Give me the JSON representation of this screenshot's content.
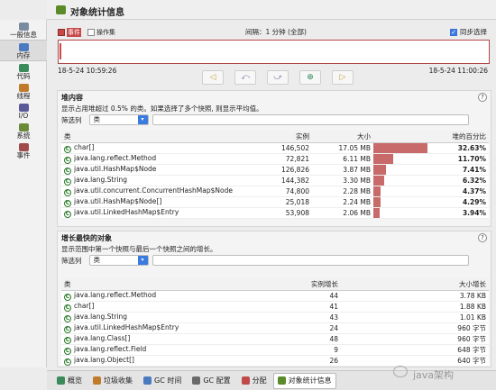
{
  "title": "对象统计信息",
  "sidebar": {
    "items": [
      {
        "label": "一般信息",
        "icon": "general-info-icon",
        "color": "#7a8aa0"
      },
      {
        "label": "内存",
        "icon": "memory-icon",
        "color": "#4a7abf"
      },
      {
        "label": "代码",
        "icon": "code-icon",
        "color": "#3a8a5a"
      },
      {
        "label": "线程",
        "icon": "threads-icon",
        "color": "#c07a2a"
      },
      {
        "label": "I/O",
        "icon": "io-icon",
        "color": "#5a5a9a"
      },
      {
        "label": "系统",
        "icon": "system-icon",
        "color": "#6a8a3a"
      },
      {
        "label": "事件",
        "icon": "events-icon",
        "color": "#a04a4a"
      }
    ],
    "active_index": 1
  },
  "timeline": {
    "legend": [
      {
        "label": "事件",
        "highlight": true
      },
      {
        "label": "操作集",
        "highlight": false
      }
    ],
    "interval": "间隔：1 分钟 (全部)",
    "sync_label": "同步选择",
    "sync_checked": true,
    "start_time": "18-5-24 10:59:26",
    "end_time": "18-5-24 11:00:26",
    "nav_buttons": [
      "◁",
      "⤺",
      "⤻",
      "⊕",
      "▷"
    ]
  },
  "heap": {
    "heading": "堆内容",
    "description": "显示占用堆超过 0.5% 的类。如果选择了多个快照, 则显示平均值。",
    "filter_label": "筛选列",
    "filter_value": "类",
    "columns": [
      "类",
      "实例",
      "大小",
      "堆的百分比"
    ],
    "rows": [
      {
        "name": "char[]",
        "instances": "146,502",
        "size": "17.05 MB",
        "percent": "32.63%",
        "fraction": 0.3263
      },
      {
        "name": "java.lang.reflect.Method",
        "instances": "72,821",
        "size": "6.11 MB",
        "percent": "11.70%",
        "fraction": 0.117
      },
      {
        "name": "java.util.HashMap$Node",
        "instances": "126,826",
        "size": "3.87 MB",
        "percent": "7.41%",
        "fraction": 0.0741
      },
      {
        "name": "java.lang.String",
        "instances": "144,382",
        "size": "3.30 MB",
        "percent": "6.32%",
        "fraction": 0.0632
      },
      {
        "name": "java.util.concurrent.ConcurrentHashMap$Node",
        "instances": "74,800",
        "size": "2.28 MB",
        "percent": "4.37%",
        "fraction": 0.0437
      },
      {
        "name": "java.util.HashMap$Node[]",
        "instances": "25,018",
        "size": "2.24 MB",
        "percent": "4.29%",
        "fraction": 0.0429
      },
      {
        "name": "java.util.LinkedHashMap$Entry",
        "instances": "53,908",
        "size": "2.06 MB",
        "percent": "3.94%",
        "fraction": 0.0394
      }
    ]
  },
  "growth": {
    "heading": "增长最快的对象",
    "description": "显示范围中第一个快照与最后一个快照之间的增长。",
    "filter_label": "筛选列",
    "filter_value": "类",
    "columns": [
      "类",
      "实例增长",
      "大小增长"
    ],
    "rows": [
      {
        "name": "java.lang.reflect.Method",
        "growth": "44",
        "size_growth": "3.78 KB"
      },
      {
        "name": "char[]",
        "growth": "41",
        "size_growth": "1.88 KB"
      },
      {
        "name": "java.lang.String",
        "growth": "43",
        "size_growth": "1.01 KB"
      },
      {
        "name": "java.util.LinkedHashMap$Entry",
        "growth": "24",
        "size_growth": "960 字节"
      },
      {
        "name": "java.lang.Class[]",
        "growth": "48",
        "size_growth": "960 字节"
      },
      {
        "name": "java.lang.reflect.Field",
        "growth": "9",
        "size_growth": "648 字节"
      },
      {
        "name": "java.lang.Object[]",
        "growth": "26",
        "size_growth": "640 字节"
      }
    ]
  },
  "tabs": [
    {
      "label": "概览",
      "icon": "overview-icon",
      "color": "#3a8a5a"
    },
    {
      "label": "垃圾收集",
      "icon": "gc-icon",
      "color": "#c07a2a"
    },
    {
      "label": "GC 时间",
      "icon": "gc-time-icon",
      "color": "#4a7abf"
    },
    {
      "label": "GC 配置",
      "icon": "gc-config-icon",
      "color": "#6a6a6a"
    },
    {
      "label": "分配",
      "icon": "allocation-icon",
      "color": "#c04a4a"
    },
    {
      "label": "对象统计信息",
      "icon": "object-stats-icon",
      "color": "#5a8a2a"
    }
  ],
  "active_tab": 5,
  "watermark": "java架构"
}
